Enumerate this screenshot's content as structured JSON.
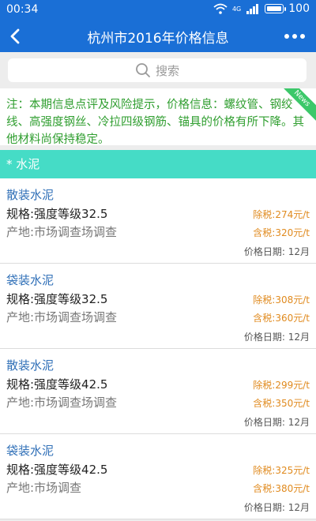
{
  "status": {
    "time": "00:34",
    "battery": "100",
    "network": "4G"
  },
  "header": {
    "title": "杭州市2016年价格信息"
  },
  "search": {
    "placeholder": "搜索"
  },
  "notice": {
    "text": "注：本期信息点评及风险提示，价格信息：螺纹管、钢绞线、高强度钢丝、冷拉四级钢筋、锚具的价格有所下降。其他材料尚保持稳定。",
    "badge": "News"
  },
  "category": {
    "label": "* 水泥"
  },
  "items": [
    {
      "name": "散装水泥",
      "spec": "规格:强度等级32.5",
      "origin": "产地:市场调查场调查",
      "price_ex": "除税:274元/t",
      "price_in": "含税:320元/t",
      "date": "价格日期: 12月"
    },
    {
      "name": "袋装水泥",
      "spec": "规格:强度等级32.5",
      "origin": "产地:市场调查场调查",
      "price_ex": "除税:308元/t",
      "price_in": "含税:360元/t",
      "date": "价格日期: 12月"
    },
    {
      "name": "散装水泥",
      "spec": "规格:强度等级42.5",
      "origin": "产地:市场调查场调查",
      "price_ex": "除税:299元/t",
      "price_in": "含税:350元/t",
      "date": "价格日期: 12月"
    },
    {
      "name": "袋装水泥",
      "spec": "规格:强度等级42.5",
      "origin": "产地:市场调查",
      "price_ex": "除税:325元/t",
      "price_in": "含税:380元/t",
      "date": "价格日期: 12月"
    }
  ]
}
